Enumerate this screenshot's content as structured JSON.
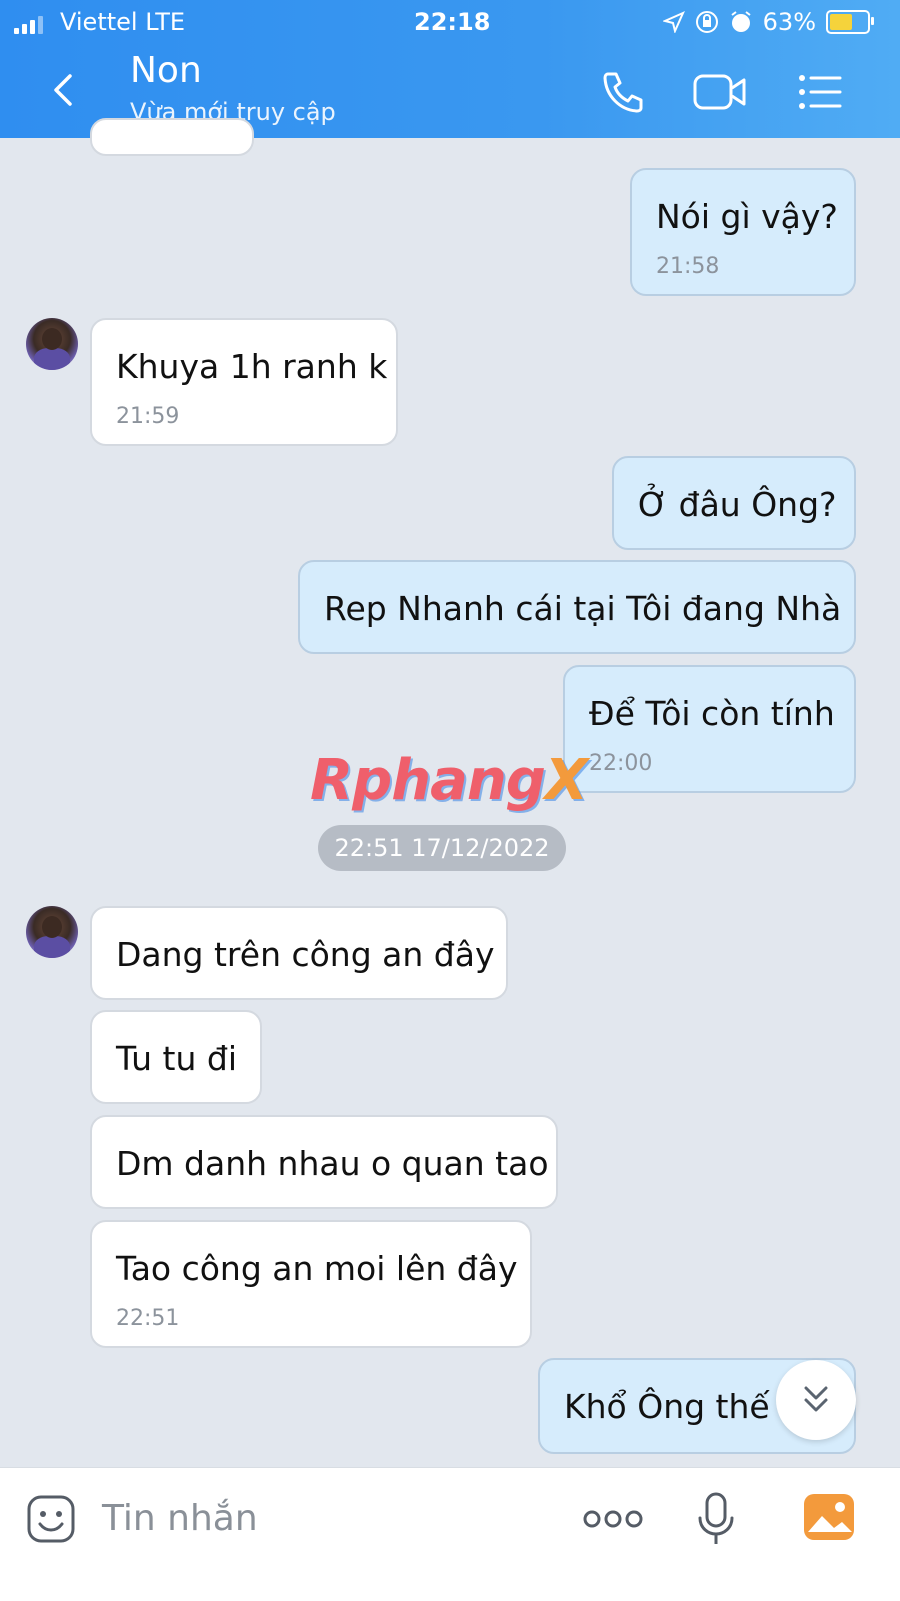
{
  "status_bar": {
    "carrier": "Viettel  LTE",
    "time": "22:18",
    "battery": "63%"
  },
  "header": {
    "title": "Non",
    "subtitle": "Vừa mới truy cập",
    "icons": [
      "back-icon",
      "phone-icon",
      "video-call-icon",
      "menu-icon"
    ]
  },
  "messages": [
    {
      "side": "out",
      "text": "Nói gì vậy?",
      "time": "21:58"
    },
    {
      "side": "in",
      "text": "Khuya 1h ranh k",
      "time": "21:59"
    },
    {
      "side": "out",
      "text": "Ở đâu Ông?"
    },
    {
      "side": "out",
      "text": "Rep Nhanh cái tại Tôi đang Nhà"
    },
    {
      "side": "out",
      "text": "Để Tôi còn tính",
      "time": "22:00"
    },
    {
      "side": "in",
      "text": "Dang trên công an đây"
    },
    {
      "side": "in",
      "text": "Tu tu đi"
    },
    {
      "side": "in",
      "text": "Dm danh nhau o quan tao"
    },
    {
      "side": "in",
      "text": "Tao công an moi lên đây",
      "time": "22:51"
    },
    {
      "side": "out",
      "text": "Khổ Ông thế 😅"
    }
  ],
  "date_separator": "22:51 17/12/2022",
  "watermark": {
    "main": "Rphang",
    "accent": "X"
  },
  "input": {
    "placeholder": "Tin nhắn",
    "icons": [
      "sticker-icon",
      "more-icon",
      "microphone-icon",
      "image-icon"
    ]
  },
  "colors": {
    "header": "#3a98f0",
    "outgoing_bubble": "#d6ecfc",
    "incoming_bubble": "#ffffff",
    "background": "#e2e7ee"
  }
}
